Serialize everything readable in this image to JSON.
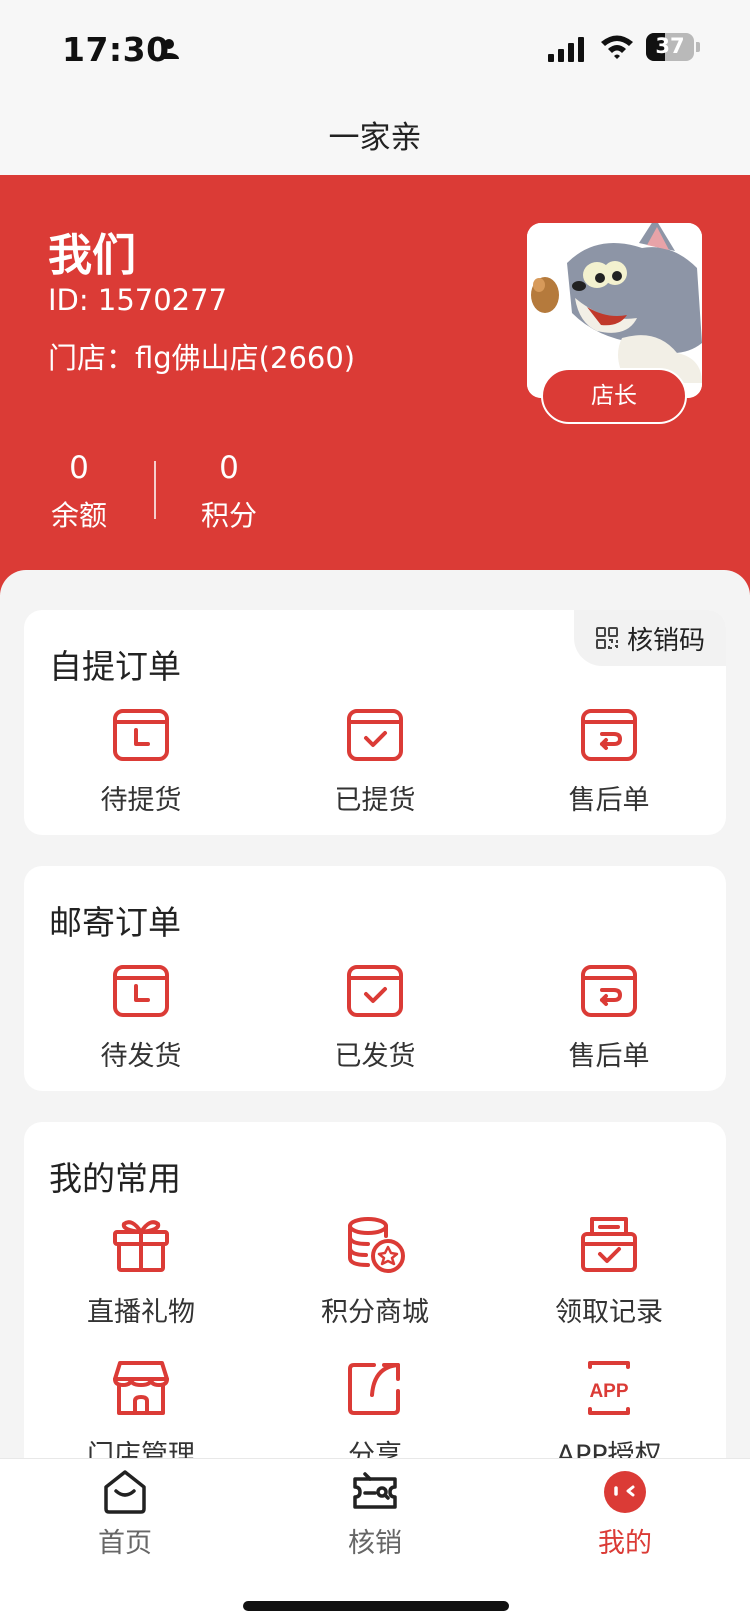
{
  "status_bar": {
    "time": "17:30",
    "battery": "37"
  },
  "nav": {
    "title": "一家亲"
  },
  "profile": {
    "name": "我们",
    "id_text": "ID: 1570277",
    "store_text": "门店：flg佛山店(2660)",
    "role": "店长",
    "balance_value": "0",
    "balance_label": "余额",
    "points_value": "0",
    "points_label": "积分"
  },
  "self_pickup": {
    "title": "自提订单",
    "qr_label": "核销码",
    "items": [
      {
        "label": "待提货",
        "icon": "calendar-pending-icon"
      },
      {
        "label": "已提货",
        "icon": "calendar-check-icon"
      },
      {
        "label": "售后单",
        "icon": "calendar-return-icon"
      }
    ]
  },
  "mail_orders": {
    "title": "邮寄订单",
    "items": [
      {
        "label": "待发货",
        "icon": "calendar-pending-icon"
      },
      {
        "label": "已发货",
        "icon": "calendar-check-icon"
      },
      {
        "label": "售后单",
        "icon": "calendar-return-icon"
      }
    ]
  },
  "common": {
    "title": "我的常用",
    "items": [
      {
        "label": "直播礼物",
        "icon": "gift-icon"
      },
      {
        "label": "积分商城",
        "icon": "coins-star-icon"
      },
      {
        "label": "领取记录",
        "icon": "receipt-check-icon"
      },
      {
        "label": "门店管理",
        "icon": "store-icon"
      },
      {
        "label": "分享",
        "icon": "share-icon"
      },
      {
        "label": "APP授权",
        "icon": "app-icon"
      }
    ]
  },
  "tabbar": {
    "items": [
      {
        "label": "首页",
        "icon": "home-icon",
        "active": false
      },
      {
        "label": "核销",
        "icon": "ticket-icon",
        "active": false
      },
      {
        "label": "我的",
        "icon": "profile-icon",
        "active": true
      }
    ]
  },
  "colors": {
    "brand": "#db3b36",
    "background": "#f4f4f4"
  }
}
